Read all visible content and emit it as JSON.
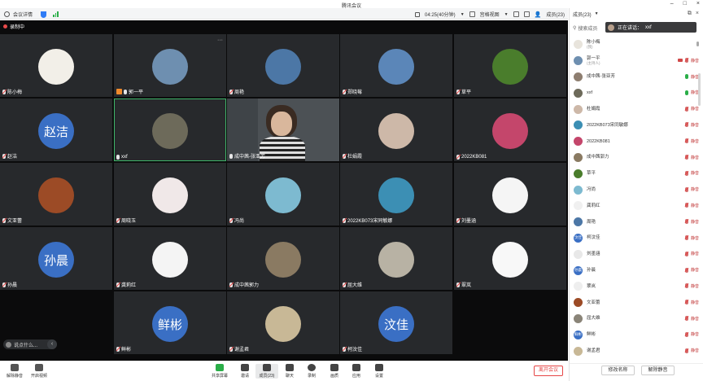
{
  "window": {
    "title": "腾讯会议"
  },
  "topbar": {
    "meeting_details": "会议详情",
    "timer": "04:25(40分钟)",
    "gallery_view": "宫格视图",
    "members_count": "成员(23)"
  },
  "stage": {
    "recording": "录制中",
    "chat_preview": "说点什么..."
  },
  "colors": {
    "accent": "#2f7cf6",
    "speaking": "#3fb66a",
    "danger": "#e64646",
    "avatar_text_bg": "#3a6fc4"
  },
  "tiles": [
    {
      "name": "陈小梅",
      "avatar": "",
      "mic": "off",
      "bg": "#f2efe8"
    },
    {
      "name": "郭一平",
      "avatar": "",
      "mic": "host",
      "bg": "#6e8fb0"
    },
    {
      "name": "周艳",
      "avatar": "",
      "mic": "off",
      "bg": "#4c77a6"
    },
    {
      "name": "郑晓莓",
      "avatar": "",
      "mic": "off",
      "bg": "#5b86b8"
    },
    {
      "name": "草平",
      "avatar": "",
      "mic": "off",
      "bg": "#4a7d2c"
    },
    {
      "name": "赵洁",
      "avatar": "赵洁",
      "mic": "off",
      "bg": "#3a6fc4"
    },
    {
      "name": "xxf",
      "avatar": "",
      "mic": "on",
      "bg": "#6d6a5a",
      "speaking": true
    },
    {
      "name": "成中茜-张亚芳",
      "avatar": "video",
      "mic": "on",
      "bg": "#4c5155"
    },
    {
      "name": "杜娟霞",
      "avatar": "",
      "mic": "off",
      "bg": "#cdb8a8"
    },
    {
      "name": "2022KB081",
      "avatar": "",
      "mic": "off",
      "bg": "#c4466b"
    },
    {
      "name": "文亚蕾",
      "avatar": "",
      "mic": "off",
      "bg": "#9c4b26"
    },
    {
      "name": "周晓玉",
      "avatar": "",
      "mic": "off",
      "bg": "#f0e8e8"
    },
    {
      "name": "冯尚",
      "avatar": "",
      "mic": "off",
      "bg": "#7dbad0"
    },
    {
      "name": "2022KB073宋同敏娜",
      "avatar": "",
      "mic": "off",
      "bg": "#3c8fb4"
    },
    {
      "name": "刘墨涵",
      "avatar": "",
      "mic": "off",
      "bg": "#f5f5f5"
    },
    {
      "name": "孙晨",
      "avatar": "孙晨",
      "mic": "off",
      "bg": "#3a6fc4"
    },
    {
      "name": "龚莉红",
      "avatar": "",
      "mic": "off",
      "bg": "#f4f4f4"
    },
    {
      "name": "成中茜郭力",
      "avatar": "",
      "mic": "off",
      "bg": "#8a7a62"
    },
    {
      "name": "屈大维",
      "avatar": "",
      "mic": "off",
      "bg": "#b8b2a4"
    },
    {
      "name": "翠岚",
      "avatar": "",
      "mic": "off",
      "bg": "#f8f8f8"
    },
    {
      "name": "鲜彬",
      "avatar": "鲜彬",
      "mic": "off",
      "bg": "#3a6fc4"
    },
    {
      "name": "谢孟君",
      "avatar": "",
      "mic": "off",
      "bg": "#c8b896"
    },
    {
      "name": "柯汶佳",
      "avatar": "汶佳",
      "mic": "off",
      "bg": "#3a6fc4"
    }
  ],
  "bottombar": {
    "items": [
      {
        "label": "解除静音",
        "icon": "mic-icon"
      },
      {
        "label": "开启视频",
        "icon": "camera-icon"
      },
      {
        "label": "共享屏幕",
        "icon": "share-screen-icon"
      },
      {
        "label": "邀请",
        "icon": "invite-icon"
      },
      {
        "label": "成员(23)",
        "icon": "members-icon"
      },
      {
        "label": "聊天",
        "icon": "chat-icon"
      },
      {
        "label": "录制",
        "icon": "record-icon"
      },
      {
        "label": "画质",
        "icon": "quality-icon"
      },
      {
        "label": "应用",
        "icon": "apps-icon"
      },
      {
        "label": "设置",
        "icon": "settings-icon"
      }
    ],
    "leave": "离开会议"
  },
  "panel": {
    "search_placeholder": "搜索成员",
    "speaking_label": "正在讲话：",
    "speaking_name": "xxf",
    "members": [
      {
        "name": "陈小梅",
        "role": "(我)",
        "mic": "gray",
        "right": "",
        "bg": "#e8e4dc",
        "av": ""
      },
      {
        "name": "郭一平",
        "role": "(主持人)",
        "mic": "off",
        "right": "",
        "bg": "#6e8fb0",
        "av": "",
        "cam": true
      },
      {
        "name": "成中茜-张亚芳",
        "role": "",
        "mic": "on",
        "right": "",
        "bg": "#8e7e70",
        "av": ""
      },
      {
        "name": "xxf",
        "role": "",
        "mic": "on",
        "right": "",
        "bg": "#6d6a5a",
        "av": ""
      },
      {
        "name": "杜娟霞",
        "role": "",
        "mic": "off",
        "right": "",
        "bg": "#cdb8a8",
        "av": ""
      },
      {
        "name": "2022KB073宋同敏娜",
        "role": "",
        "mic": "off",
        "right": "",
        "bg": "#3c8fb4",
        "av": ""
      },
      {
        "name": "2022KB081",
        "role": "",
        "mic": "off",
        "right": "",
        "bg": "#c4466b",
        "av": ""
      },
      {
        "name": "成中茜郭力",
        "role": "",
        "mic": "off",
        "right": "",
        "bg": "#8a7a62",
        "av": ""
      },
      {
        "name": "草平",
        "role": "",
        "mic": "off",
        "right": "",
        "bg": "#4a7d2c",
        "av": ""
      },
      {
        "name": "冯尚",
        "role": "",
        "mic": "off",
        "right": "",
        "bg": "#7dbad0",
        "av": ""
      },
      {
        "name": "龚莉红",
        "role": "",
        "mic": "off",
        "right": "",
        "bg": "#f0f0f0",
        "av": ""
      },
      {
        "name": "周艳",
        "role": "",
        "mic": "off",
        "right": "",
        "bg": "#4c77a6",
        "av": ""
      },
      {
        "name": "柯汶佳",
        "role": "",
        "mic": "off",
        "right": "",
        "bg": "#3a6fc4",
        "av": "汶佳"
      },
      {
        "name": "刘墨涵",
        "role": "",
        "mic": "off",
        "right": "",
        "bg": "#e8e8e8",
        "av": ""
      },
      {
        "name": "孙晨",
        "role": "",
        "mic": "off",
        "right": "",
        "bg": "#3a6fc4",
        "av": "孙晨"
      },
      {
        "name": "翠岚",
        "role": "",
        "mic": "off",
        "right": "",
        "bg": "#eeeeee",
        "av": ""
      },
      {
        "name": "文亚蕾",
        "role": "",
        "mic": "off",
        "right": "",
        "bg": "#9c4b26",
        "av": ""
      },
      {
        "name": "屈大维",
        "role": "",
        "mic": "off",
        "right": "",
        "bg": "#8a8478",
        "av": ""
      },
      {
        "name": "鲜彬",
        "role": "",
        "mic": "off",
        "right": "",
        "bg": "#3a6fc4",
        "av": "鲜彬"
      },
      {
        "name": "谢孟君",
        "role": "",
        "mic": "off",
        "right": "",
        "bg": "#c8b896",
        "av": ""
      }
    ],
    "mute_label": "静音",
    "rename": "修改名称",
    "unmute_all": "解除静音"
  }
}
